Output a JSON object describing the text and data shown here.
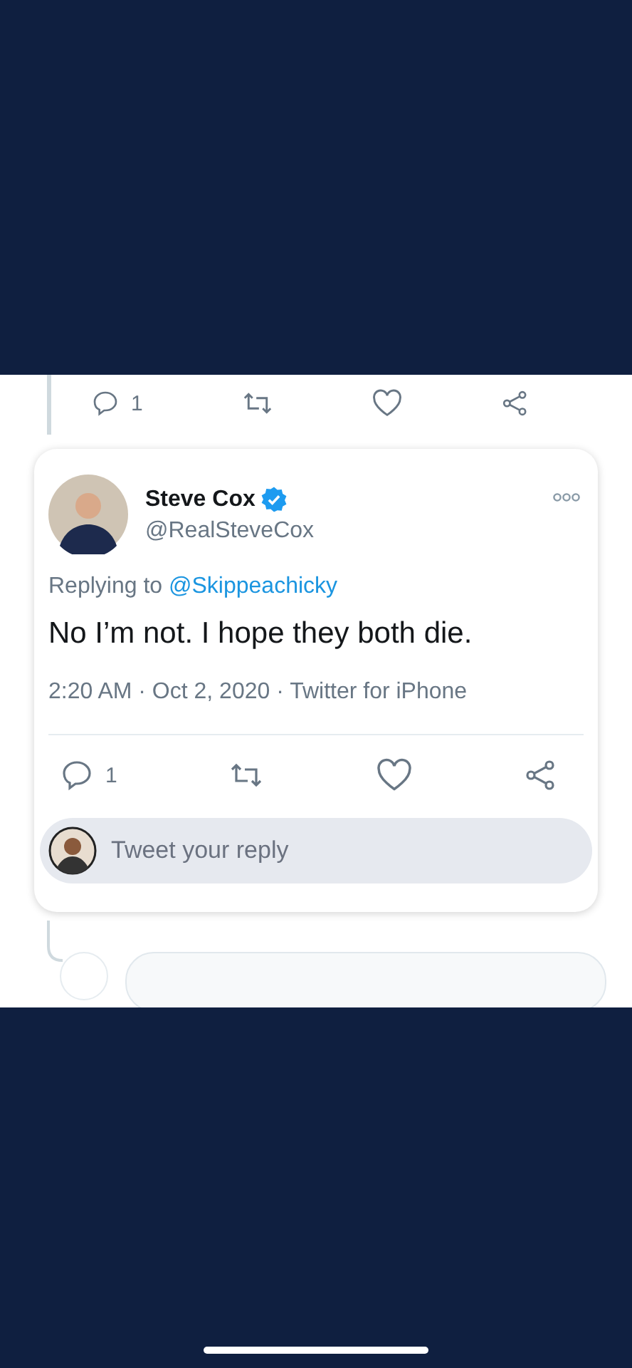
{
  "previous_tweet_actions": {
    "reply_count": "1"
  },
  "tweet": {
    "name": "Steve Cox",
    "verified": true,
    "handle": "@RealSteveCox",
    "replying_label": "Replying to",
    "replying_to": "@Skippeachicky",
    "text": "No I’m not. I hope they both die.",
    "meta": "2:20 AM · Oct 2, 2020 · Twitter for iPhone",
    "reply_count": "1"
  },
  "reply_field": {
    "placeholder": "Tweet your reply"
  }
}
